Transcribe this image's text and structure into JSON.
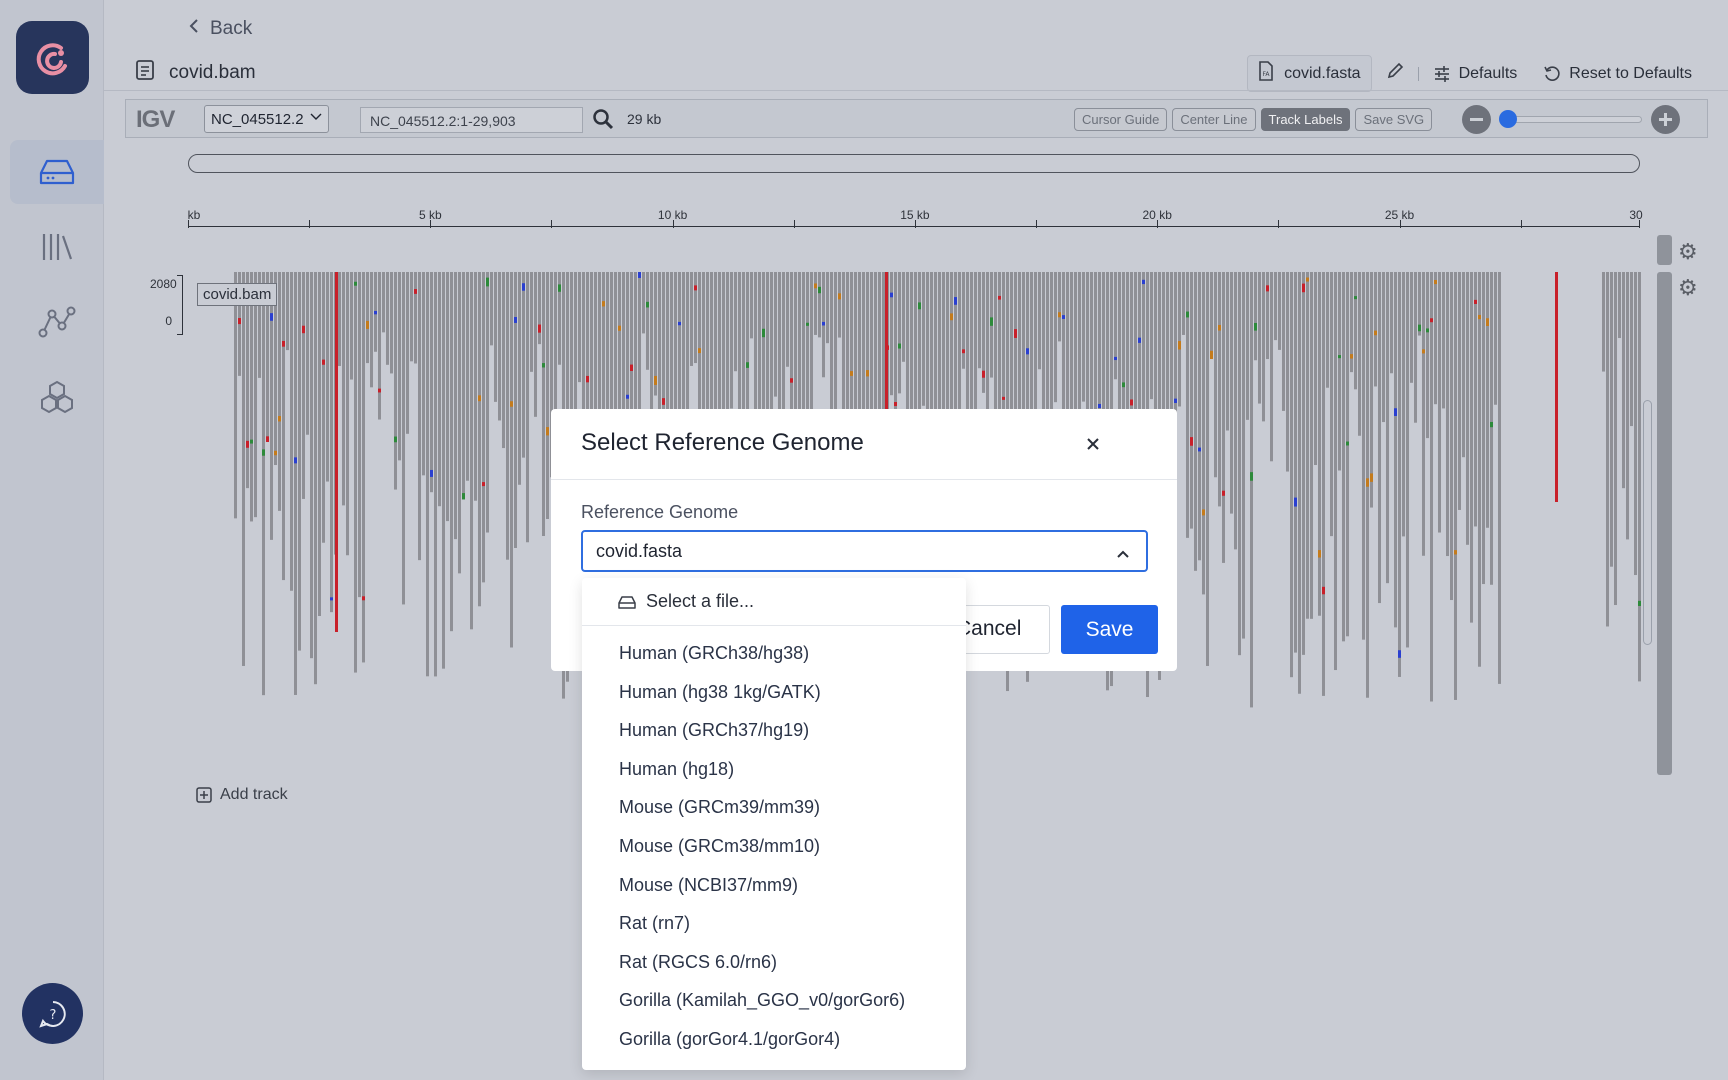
{
  "nav": {
    "back_label": "Back",
    "file_name": "covid.bam",
    "reference_chip": "covid.fasta",
    "defaults_label": "Defaults",
    "reset_label": "Reset to Defaults"
  },
  "sidebar": {
    "items": [
      {
        "icon": "drive-icon",
        "active": true
      },
      {
        "icon": "library-icon",
        "active": false
      },
      {
        "icon": "graph-icon",
        "active": false
      },
      {
        "icon": "hexagons-icon",
        "active": false
      }
    ]
  },
  "igv": {
    "logo": "IGV",
    "chromosome": "NC_045512.2",
    "locus": "NC_045512.2:1-29,903",
    "span": "29 kb",
    "buttons": [
      {
        "label": "Cursor Guide",
        "active": false
      },
      {
        "label": "Center Line",
        "active": false
      },
      {
        "label": "Track Labels",
        "active": true
      },
      {
        "label": "Save SVG",
        "active": false
      }
    ],
    "zoom_level": 0.03,
    "ruler_ticks": [
      "kb",
      "5 kb",
      "10 kb",
      "15 kb",
      "20 kb",
      "25 kb",
      "30"
    ],
    "track": {
      "label": "covid.bam",
      "coverage_max": "2080",
      "coverage_min": "0"
    },
    "add_track": "Add track"
  },
  "modal": {
    "title": "Select Reference Genome",
    "field_label": "Reference Genome",
    "selected": "covid.fasta",
    "cancel_label": "Cancel",
    "save_label": "Save",
    "dropdown": {
      "file_option": "Select a file...",
      "options": [
        "Human (GRCh38/hg38)",
        "Human (hg38 1kg/GATK)",
        "Human (GRCh37/hg19)",
        "Human (hg18)",
        "Mouse (GRCm39/mm39)",
        "Mouse (GRCm38/mm10)",
        "Mouse (NCBI37/mm9)",
        "Rat (rn7)",
        "Rat (RGCS 6.0/rn6)",
        "Gorilla (Kamilah_GGO_v0/gorGor6)",
        "Gorilla (gorGor4.1/gorGor4)"
      ]
    }
  },
  "colors": {
    "accent": "#1f63e8",
    "logo_bg": "#27355c",
    "read_gray": "#8f9096"
  }
}
